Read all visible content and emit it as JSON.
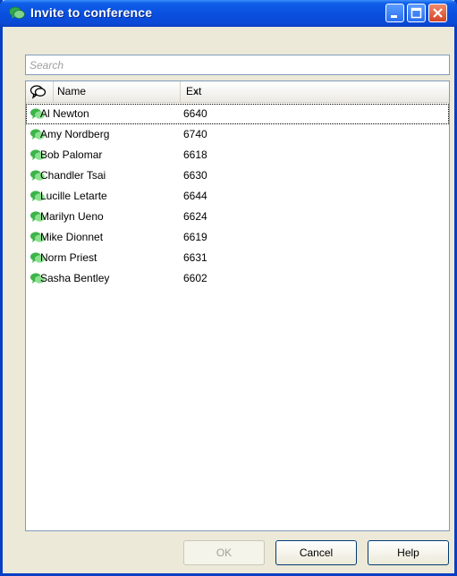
{
  "window": {
    "title": "Invite to conference"
  },
  "search": {
    "placeholder": "Search"
  },
  "columns": {
    "name": "Name",
    "ext": "Ext"
  },
  "contacts": [
    {
      "name": "Al Newton",
      "ext": "6640"
    },
    {
      "name": "Amy Nordberg",
      "ext": "6740"
    },
    {
      "name": "Bob Palomar",
      "ext": "6618"
    },
    {
      "name": "Chandler Tsai",
      "ext": "6630"
    },
    {
      "name": "Lucille Letarte",
      "ext": "6644"
    },
    {
      "name": "Marilyn Ueno",
      "ext": "6624"
    },
    {
      "name": "Mike Dionnet",
      "ext": "6619"
    },
    {
      "name": "Norm Priest",
      "ext": "6631"
    },
    {
      "name": "Sasha Bentley",
      "ext": "6602"
    }
  ],
  "buttons": {
    "ok": "OK",
    "cancel": "Cancel",
    "help": "Help"
  },
  "colors": {
    "titlebar": "#0a4fe0",
    "window_bg": "#ece9d8",
    "presence_green": "#3cb44a"
  }
}
